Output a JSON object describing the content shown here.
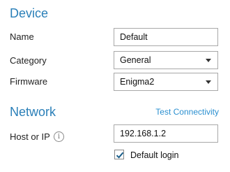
{
  "device": {
    "title": "Device",
    "name_label": "Name",
    "name_value": "Default",
    "category_label": "Category",
    "category_value": "General",
    "firmware_label": "Firmware",
    "firmware_value": "Enigma2"
  },
  "network": {
    "title": "Network",
    "test_link": "Test Connectivity",
    "host_label": "Host or IP",
    "info_glyph": "i",
    "host_value": "192.168.1.2",
    "default_login_label": "Default login",
    "default_login_checked": true
  },
  "colors": {
    "section_title": "#2a7fb8",
    "link": "#2a8fd0",
    "check": "#1a5e8a"
  }
}
